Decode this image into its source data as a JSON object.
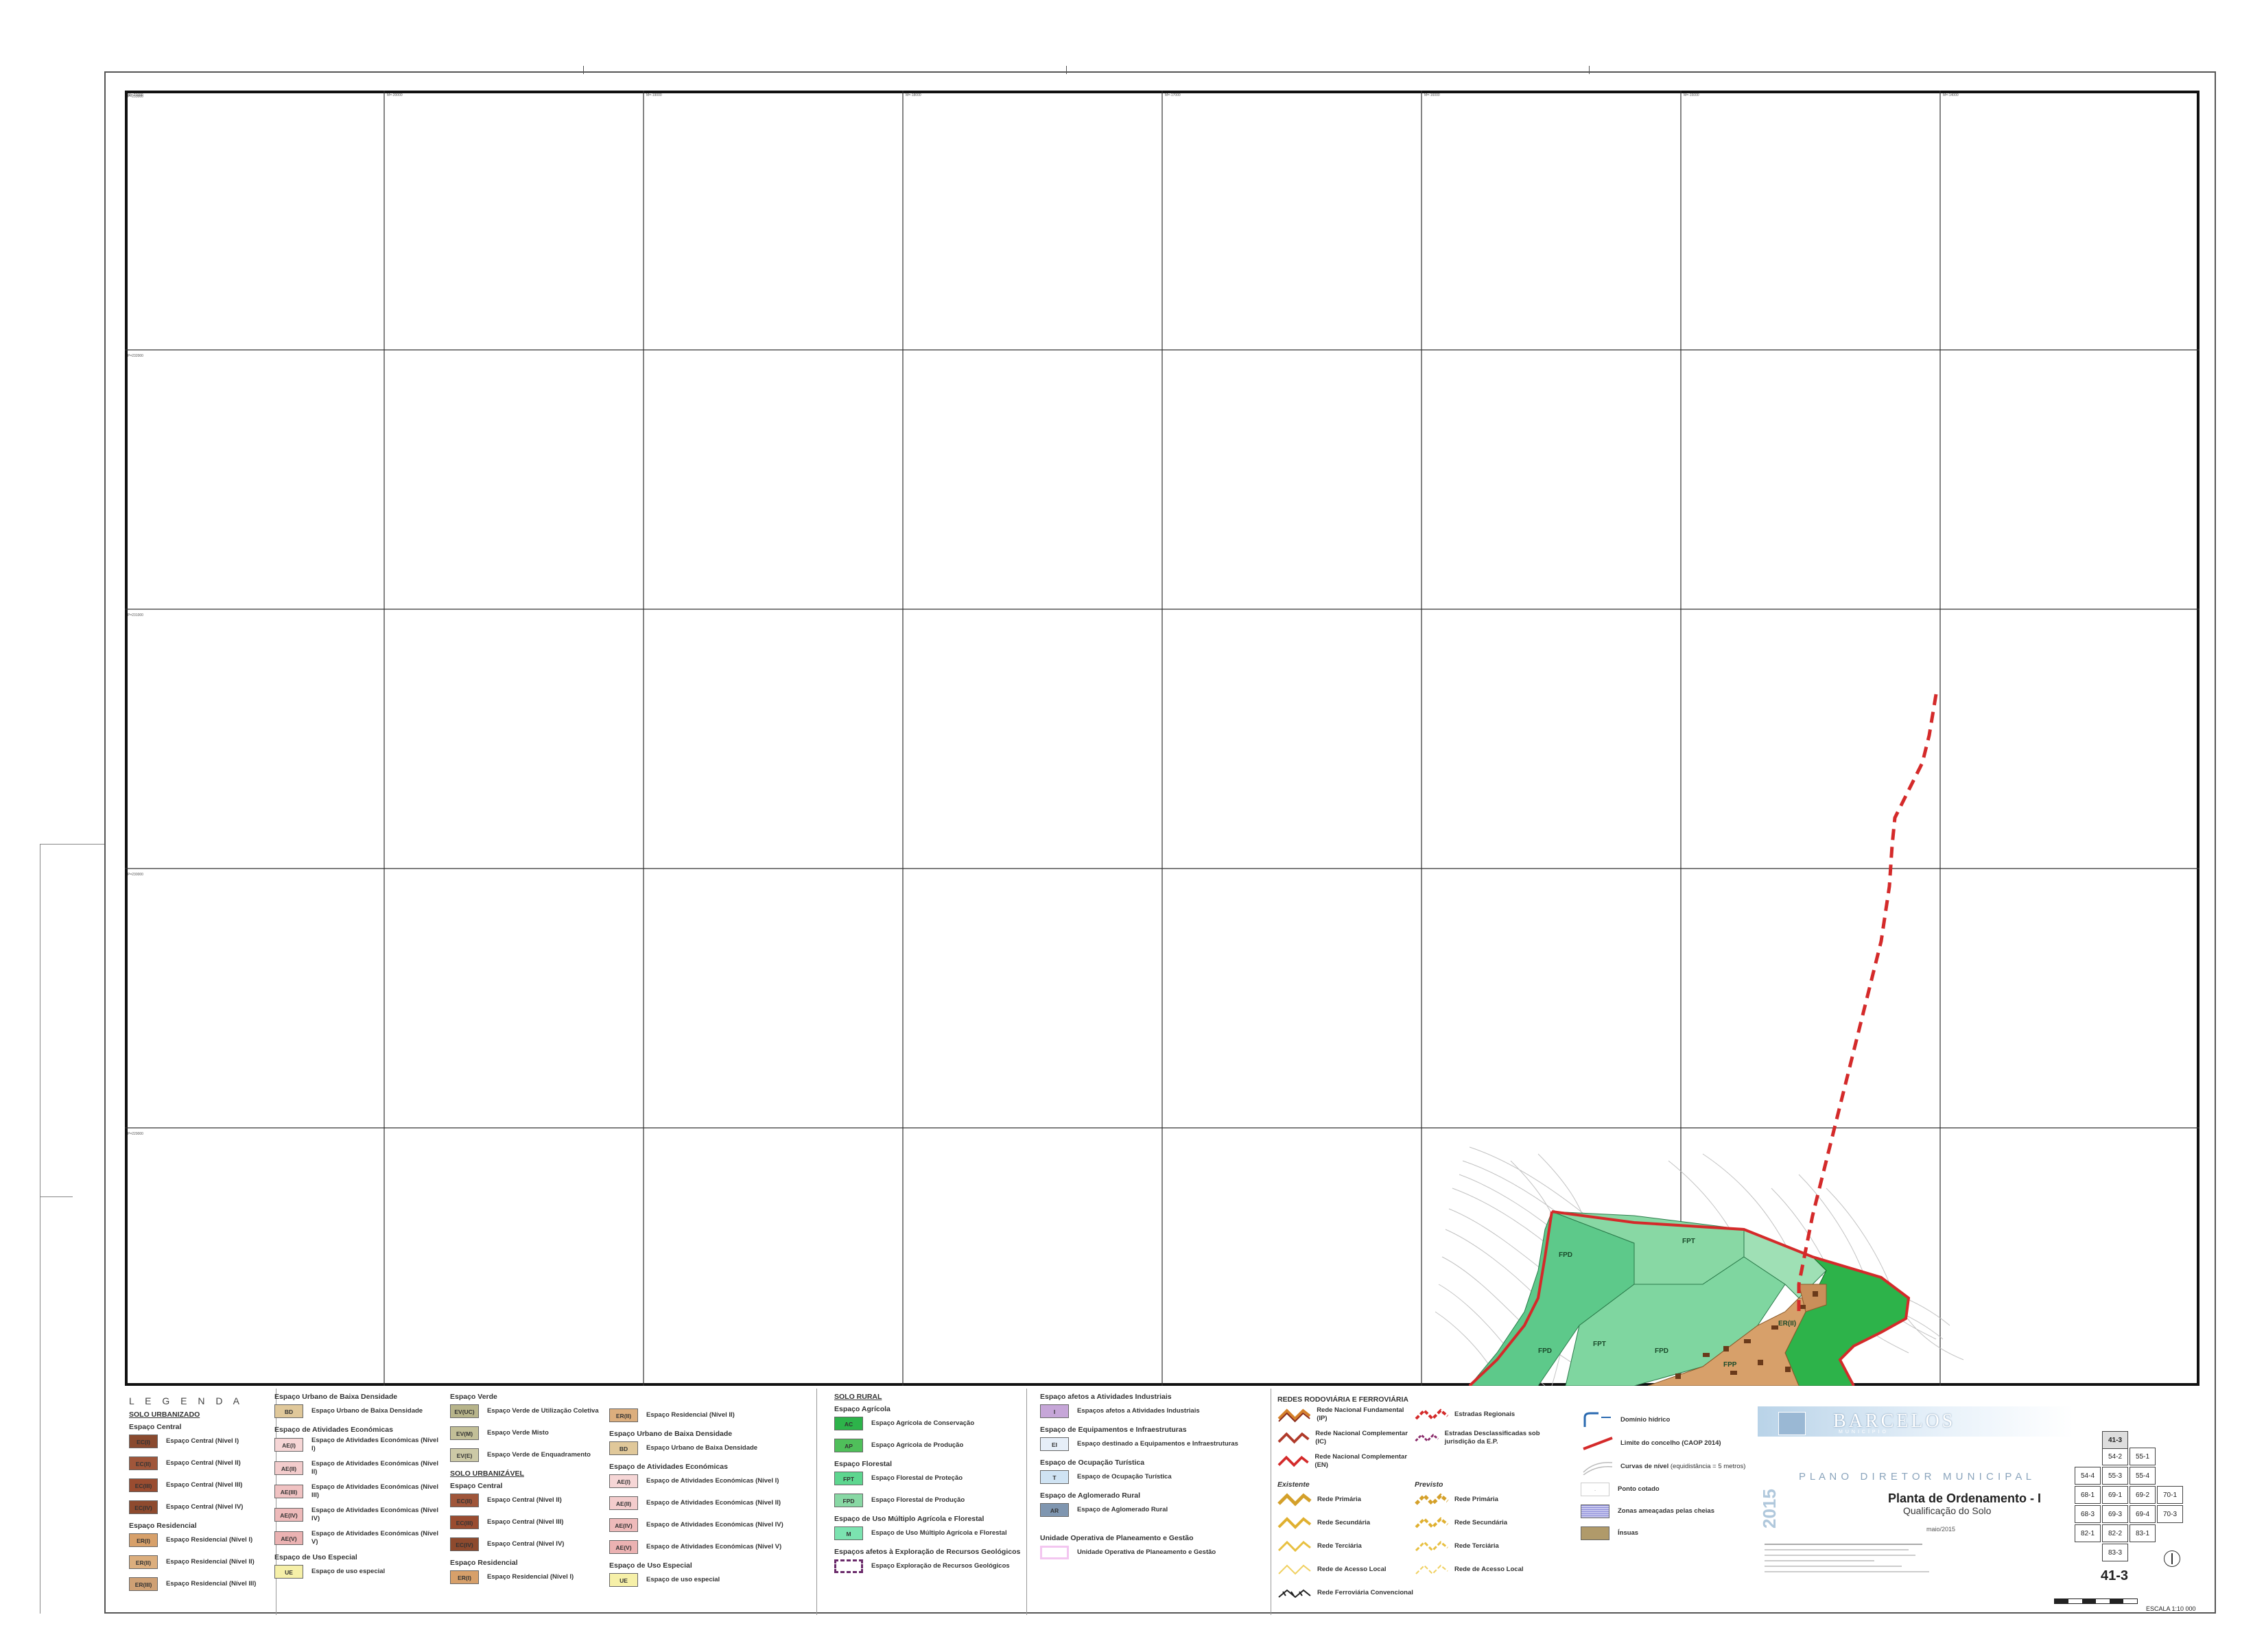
{
  "map": {
    "tick_labels_top": [
      "M=-21000",
      "M=-20000",
      "M=-19000",
      "M=-18000",
      "M=-17000",
      "M=-16000",
      "M=-15000",
      "M=-14000",
      "M=-13000"
    ],
    "tick_labels_left": [
      "P=233000",
      "P=232000",
      "P=231000",
      "P=230000",
      "P=229000",
      "P=228000"
    ],
    "zone_labels": [
      "FPD",
      "FPT",
      "FPD",
      "FPT",
      "FPD",
      "ER(II)",
      "FPP"
    ],
    "colors": {
      "boundary": "#d42a2a",
      "forest_production": "#5dc98a",
      "forest_protection": "#88d8a4",
      "agri_conservation": "#2db34a",
      "residential": "#d7a06a",
      "contour": "#b8b8b8"
    }
  },
  "legend": {
    "title": "L E G E N D A",
    "solo_urbanizado": "SOLO URBANIZADO",
    "espaco_central": "Espaço Central",
    "central_items": [
      {
        "code": "EC(I)",
        "label": "Espaço Central (Nível I)",
        "color": "#8a4a2f"
      },
      {
        "code": "EC(II)",
        "label": "Espaço Central (Nível II)",
        "color": "#a0563a"
      },
      {
        "code": "EC(III)",
        "label": "Espaço Central (Nível III)",
        "color": "#9a4c30"
      },
      {
        "code": "EC(IV)",
        "label": "Espaço Central (Nível IV)",
        "color": "#8e4a2e"
      }
    ],
    "espaco_residencial": "Espaço Residencial",
    "residencial_items": [
      {
        "code": "ER(I)",
        "label": "Espaço Residencial (Nível I)",
        "color": "#d7a06a"
      },
      {
        "code": "ER(II)",
        "label": "Espaço Residencial (Nível II)",
        "color": "#dcae7d"
      },
      {
        "code": "ER(III)",
        "label": "Espaço Residencial (Nível III)",
        "color": "#cfa074"
      }
    ],
    "col2": {
      "h1": "Espaço Urbano de Baixa Densidade",
      "bd": {
        "code": "BD",
        "label": "Espaço Urbano de Baixa Densidade",
        "color": "#e0c89a"
      },
      "h2": "Espaço de Atividades Económicas",
      "ae_items": [
        {
          "code": "AE(I)",
          "label": "Espaço de Atividades Económicas (Nível I)",
          "color": "#f6d6d6"
        },
        {
          "code": "AE(II)",
          "label": "Espaço de Atividades Económicas (Nível II)",
          "color": "#f3cccc"
        },
        {
          "code": "AE(III)",
          "label": "Espaço de Atividades Económicas (Nível III)",
          "color": "#f0c2c2"
        },
        {
          "code": "AE(IV)",
          "label": "Espaço de Atividades Económicas (Nível IV)",
          "color": "#eebaba"
        },
        {
          "code": "AE(V)",
          "label": "Espaço de Atividades Económicas (Nível V)",
          "color": "#ebb2b2"
        }
      ],
      "h3": "Espaço de Uso Especial",
      "ue": {
        "code": "UE",
        "label": "Espaço de uso especial",
        "color": "#f6f0a8"
      }
    },
    "col3": {
      "h1": "Espaço Verde",
      "ev_items": [
        {
          "code": "EV(UC)",
          "label": "Espaço Verde de Utilização Coletiva",
          "color": "#b7b48a"
        },
        {
          "code": "EV(M)",
          "label": "Espaço Verde Misto",
          "color": "#c2bf97"
        },
        {
          "code": "EV(E)",
          "label": "Espaço Verde de Enquadramento",
          "color": "#ccc9a6"
        }
      ],
      "solo_urbanizavel": "SOLO URBANIZÁVEL",
      "h2": "Espaço Central",
      "ec_items": [
        {
          "code": "EC(II)",
          "label": "Espaço Central (Nível II)",
          "color": "#a0563a"
        },
        {
          "code": "EC(III)",
          "label": "Espaço Central (Nível III)",
          "color": "#9a4c30"
        },
        {
          "code": "EC(IV)",
          "label": "Espaço Central (Nível IV)",
          "color": "#8e4a2e"
        }
      ],
      "h3": "Espaço Residencial",
      "er": {
        "code": "ER(I)",
        "label": "Espaço Residencial (Nível I)",
        "color": "#d7a06a"
      }
    },
    "col4": {
      "er2": {
        "code": "ER(II)",
        "label": "Espaço Residencial (Nível II)",
        "color": "#dcae7d"
      },
      "h1": "Espaço Urbano de Baixa Densidade",
      "bd": {
        "code": "BD",
        "label": "Espaço Urbano de Baixa Densidade",
        "color": "#e0c89a"
      },
      "h2": "Espaço de Atividades Económicas",
      "ae_items": [
        {
          "code": "AE(I)",
          "label": "Espaço de Atividades Económicas (Nível I)",
          "color": "#f6d6d6"
        },
        {
          "code": "AE(II)",
          "label": "Espaço de Atividades Económicas (Nível II)",
          "color": "#f3cccc"
        },
        {
          "code": "AE(IV)",
          "label": "Espaço de Atividades Económicas (Nível IV)",
          "color": "#eebaba"
        },
        {
          "code": "AE(V)",
          "label": "Espaço de Atividades Económicas (Nível V)",
          "color": "#ebb2b2"
        }
      ],
      "h3": "Espaço de Uso Especial",
      "ue": {
        "code": "UE",
        "label": "Espaço de uso especial",
        "color": "#f6f0a8"
      }
    },
    "col5": {
      "solo_rural": "SOLO RURAL",
      "h1": "Espaço Agrícola",
      "agri_items": [
        {
          "code": "AC",
          "label": "Espaço Agrícola de Conservação",
          "color": "#2db34a"
        },
        {
          "code": "AP",
          "label": "Espaço Agrícola de Produção",
          "color": "#4fbf5a"
        }
      ],
      "h2": "Espaço Florestal",
      "flo_items": [
        {
          "code": "FPT",
          "label": "Espaço Florestal de Proteção",
          "color": "#5dd68f"
        },
        {
          "code": "FPD",
          "label": "Espaço Florestal de Produção",
          "color": "#88d8a4"
        }
      ],
      "h3": "Espaço de Uso Múltiplo Agrícola e Florestal",
      "m": {
        "code": "M",
        "label": "Espaço de Uso Múltiplo Agrícola e Florestal",
        "color": "#7be3b0"
      },
      "h4": "Espaços afetos à Exploração de Recursos Geológicos",
      "geo": {
        "label": "Espaço Exploração de Recursos Geológicos"
      }
    },
    "col6": {
      "h1": "Espaço afetos a Atividades Industriais",
      "ind": {
        "code": "I",
        "label": "Espaços afetos a Atividades Industriais",
        "color": "#c6a6d8"
      },
      "h2": "Espaço de Equipamentos e Infraestruturas",
      "ei": {
        "code": "EI",
        "label": "Espaço destinado a Equipamentos e Infraestruturas",
        "color": "#e6eef8"
      },
      "h3": "Espaço de Ocupação Turística",
      "t": {
        "code": "T",
        "label": "Espaço de Ocupação Turística",
        "color": "#cfe3f3"
      },
      "h4": "Espaço de Aglomerado Rural",
      "ar": {
        "code": "AR",
        "label": "Espaço de Aglomerado Rural",
        "color": "#7f96b0"
      },
      "h5": "Unidade Operativa de Planeamento e Gestão",
      "uopg": {
        "label": "Unidade Operativa de Planeamento e Gestão"
      }
    },
    "col7": {
      "h1": "REDES RODOVIÁRIA E FERROVIÁRIA",
      "rn": [
        {
          "label": "Rede Nacional Fundamental (IP)"
        },
        {
          "label": "Rede Nacional Complementar (IC)"
        },
        {
          "label": "Rede Nacional Complementar (EN)"
        }
      ],
      "er": {
        "label": "Estradas Regionais"
      },
      "desc": {
        "label": "Estradas Desclassificadas sob jurisdição da E.P."
      },
      "existente": "Existente",
      "previsto": "Previsto",
      "exist_items": [
        "Rede Primária",
        "Rede Secundária",
        "Rede Terciária",
        "Rede de Acesso Local"
      ],
      "prev_items": [
        "Rede Primária",
        "Rede Secundária",
        "Rede Terciária",
        "Rede de Acesso Local"
      ],
      "ferro": "Rede Ferroviária Convencional"
    },
    "col8": {
      "dominio": "Domínio hídrico",
      "limite": "Limite do concelho (CAOP 2014)",
      "curvas": "Curvas de nível",
      "curvas_note": "(equidistância = 5 metros)",
      "ponto": "Ponto cotado",
      "zonas": "Zonas ameaçadas pelas cheias",
      "ineuas": "Ínsuas"
    }
  },
  "titleblock": {
    "brand": "BARCELOS",
    "brand_sub": "MUNICÍPIO",
    "plan": "P L A N O   D I R E T O R   M U N I C I P A L",
    "year": "2015",
    "title": "Planta de Ordenamento - I",
    "subtitle": "Qualificação do Solo",
    "date": "maio/2015",
    "sheet": "41-3",
    "scale": "ESCALA 1:10 000",
    "index_cells": [
      "54-2",
      "55-1",
      "54-4",
      "55-3",
      "55-4",
      "68-1",
      "69-1",
      "69-2",
      "70-1",
      "68-3",
      "69-3",
      "69-4",
      "70-3",
      "82-1",
      "82-2",
      "83-1",
      "83-3",
      "41-3"
    ]
  }
}
